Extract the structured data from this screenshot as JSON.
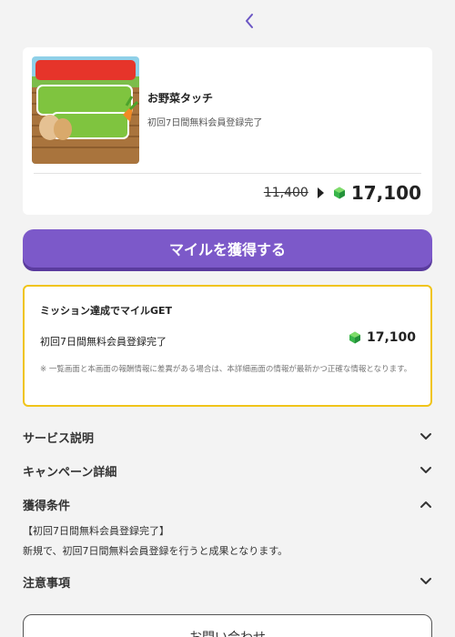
{
  "header": {
    "back_icon": "chevron-left-icon",
    "accent_color": "#6b56c4"
  },
  "app": {
    "name": "お野菜タッチ",
    "description": "初回7日間無料会員登録完了",
    "old_price": "11,400",
    "new_price": "17,100"
  },
  "cta": {
    "label": "マイルを獲得する",
    "color": "#7c59c9"
  },
  "mission": {
    "title": "ミッション達成でマイルGET",
    "condition": "初回7日間無料会員登録完了",
    "reward": "17,100",
    "note": "※ 一覧画面と本画面の報酬情報に差異がある場合は、本詳細画面の情報が最新かつ正確な情報となります。",
    "border_color": "#f0c419"
  },
  "sections": {
    "service": {
      "title": "サービス説明",
      "icon": "chevron-down-icon"
    },
    "campaign": {
      "title": "キャンペーン詳細",
      "icon": "chevron-down-icon"
    },
    "conditions": {
      "title": "獲得条件",
      "icon": "chevron-up-icon",
      "line1": "【初回7日間無料会員登録完了】",
      "line2": "新規で、初回7日間無料会員登録を行うと成果となります。"
    },
    "notes": {
      "title": "注意事項",
      "icon": "chevron-down-icon"
    }
  },
  "contact": {
    "label": "お問い合わせ"
  }
}
